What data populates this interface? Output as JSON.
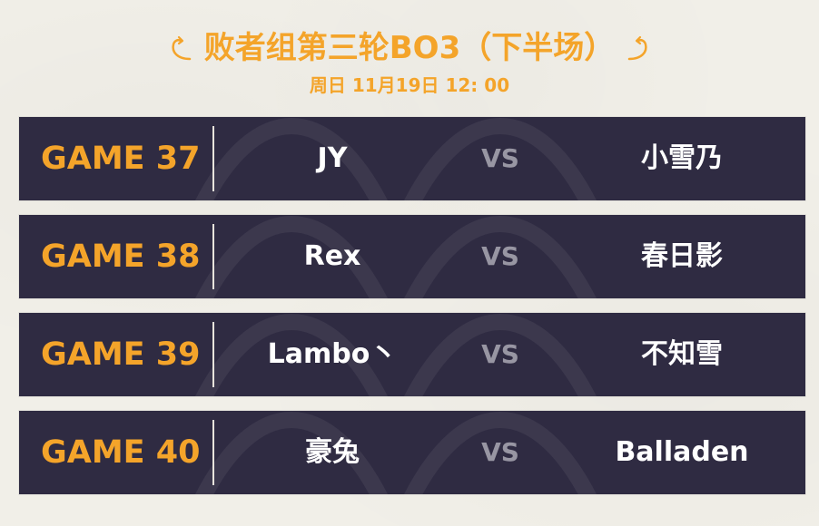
{
  "header": {
    "title": "败者组第三轮BO3（下半场）",
    "subtitle": "周日 11月19日 12: 00"
  },
  "games": [
    {
      "label": "GAME 37",
      "left": "JY",
      "vs": "VS",
      "right": "小雪乃"
    },
    {
      "label": "GAME 38",
      "left": "Rex",
      "vs": "VS",
      "right": "春日影"
    },
    {
      "label": "GAME 39",
      "left": "Lambo丶",
      "vs": "VS",
      "right": "不知雪"
    },
    {
      "label": "GAME 40",
      "left": "豪兔",
      "vs": "VS",
      "right": "Balladen"
    }
  ],
  "colors": {
    "accent": "#f4a42a",
    "row_bg": "#2f2b42",
    "page_bg": "#f1efe8",
    "vs": "#9896a3"
  },
  "icons": {
    "left_ornament": "swirl-ornament-icon",
    "right_ornament": "swirl-ornament-icon"
  }
}
